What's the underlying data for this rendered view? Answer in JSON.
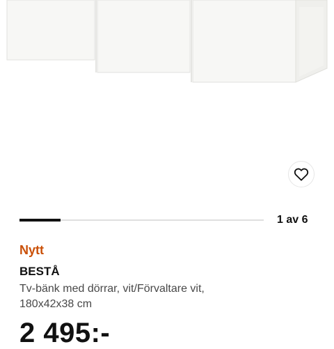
{
  "product": {
    "badge": "Nytt",
    "name": "BESTÅ",
    "description_line1": "Tv-bänk med dörrar, vit/Förvaltare vit,",
    "description_line2": "180x42x38 cm",
    "price": "2 495:-"
  },
  "gallery": {
    "indicator": "1 av 6",
    "current": 1,
    "total": 6
  },
  "icons": {
    "wishlist": "heart-icon"
  },
  "colors": {
    "badge": "#ca5008",
    "text": "#111111",
    "muted": "#484848"
  }
}
